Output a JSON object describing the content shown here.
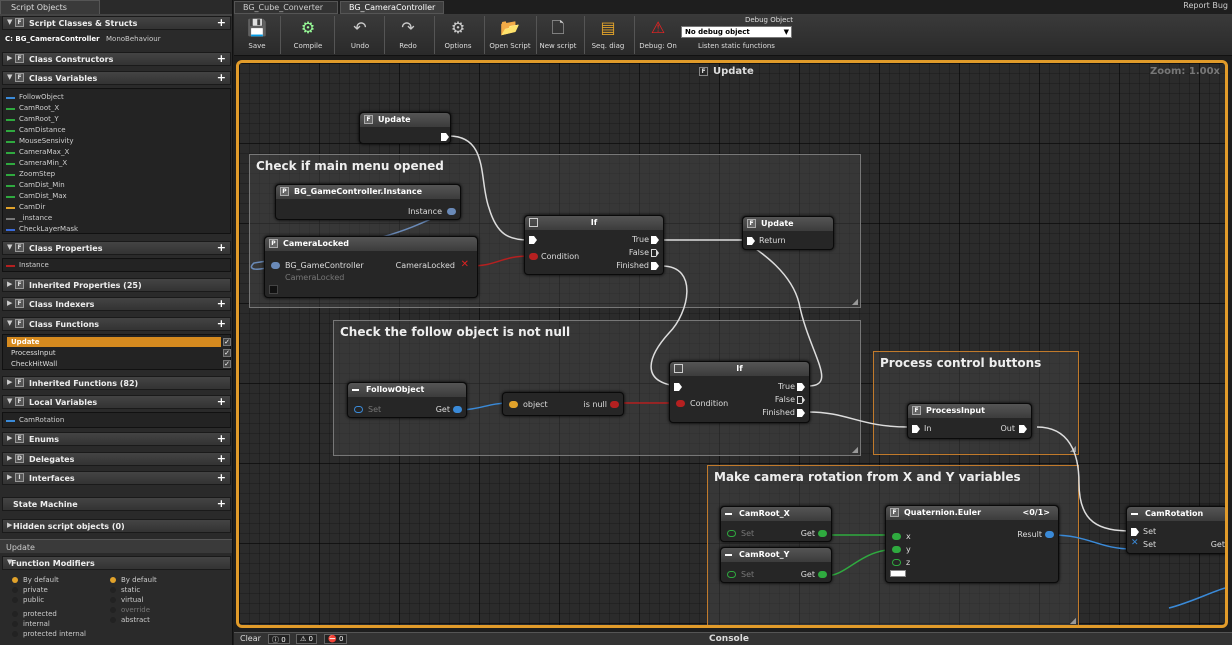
{
  "left_panel": {
    "tab": "Script Objects",
    "sections": {
      "script_classes": "Script Classes & Structs",
      "class_constructors": "Class Constructors",
      "class_variables": "Class Variables",
      "class_properties": "Class Properties",
      "inherited_properties": "Inherited Properties (25)",
      "class_indexers": "Class Indexers",
      "class_functions": "Class Functions",
      "inherited_functions": "Inherited Functions (82)",
      "local_variables": "Local Variables",
      "enums": "Enums",
      "delegates": "Delegates",
      "interfaces": "Interfaces",
      "state_machine": "State Machine",
      "hidden_objects": "Hidden script objects (0)",
      "function_modifiers": "Function Modifiers"
    },
    "class_entry": {
      "name": "C: BG_CameraController",
      "base": "MonoBehaviour"
    },
    "class_variables": [
      {
        "name": "FollowObject",
        "color": "#3a8ad8"
      },
      {
        "name": "CamRoot_X",
        "color": "#2faa3f"
      },
      {
        "name": "CamRoot_Y",
        "color": "#2faa3f"
      },
      {
        "name": "CamDistance",
        "color": "#2faa3f"
      },
      {
        "name": "MouseSensivity",
        "color": "#2faa3f"
      },
      {
        "name": "CameraMax_X",
        "color": "#2faa3f"
      },
      {
        "name": "CameraMin_X",
        "color": "#2faa3f"
      },
      {
        "name": "ZoomStep",
        "color": "#2faa3f"
      },
      {
        "name": "CamDist_Min",
        "color": "#2faa3f"
      },
      {
        "name": "CamDist_Max",
        "color": "#2faa3f"
      },
      {
        "name": "CamDir",
        "color": "#e1a22a"
      },
      {
        "name": "_instance",
        "color": "#777777"
      },
      {
        "name": "CheckLayerMask",
        "color": "#3a6ad8"
      }
    ],
    "class_properties": [
      {
        "name": "Instance",
        "color": "#b52020"
      }
    ],
    "class_functions": [
      "Update",
      "ProcessInput",
      "CheckHitWall"
    ],
    "local_variables": [
      {
        "name": "CamRotation",
        "color": "#3a8ad8"
      }
    ],
    "bottom_tab": "Update",
    "modifiers_left": [
      "By default",
      "private",
      "public",
      "protected",
      "internal",
      "protected internal"
    ],
    "modifiers_right": [
      "By default",
      "static",
      "virtual",
      "override",
      "abstract"
    ]
  },
  "tabs": [
    "BG_Cube_Converter",
    "BG_CameraController"
  ],
  "report_bug": "Report Bug",
  "toolbar": {
    "save": "Save",
    "compile": "Compile",
    "undo": "Undo",
    "redo": "Redo",
    "options": "Options",
    "open_script": "Open Script",
    "new_script": "New script",
    "seq_diag": "Seq. diag",
    "debug_on": "Debug: On",
    "debug_object_title": "Debug Object",
    "debug_object_value": "No debug object",
    "listen_static": "Listen static functions"
  },
  "graph": {
    "title": "Update",
    "zoom": "Zoom: 1.00x",
    "groups": {
      "g1": "Check if main menu opened",
      "g2": "Check the follow object is not null",
      "g3": "Process control buttons",
      "g4": "Make camera rotation from X and Y variables"
    },
    "nodes": {
      "update": {
        "title": "Update"
      },
      "instance": {
        "title": "BG_GameController.Instance",
        "out": "Instance"
      },
      "cameralocked": {
        "title": "CameraLocked",
        "in": "BG_GameController",
        "out": "CameraLocked",
        "sub": "CameraLocked"
      },
      "if1": {
        "title": "If",
        "condition": "Condition",
        "true": "True",
        "false": "False",
        "finished": "Finished"
      },
      "update_return": {
        "title": "Update",
        "return": "Return"
      },
      "follow": {
        "title": "FollowObject",
        "set": "Set",
        "get": "Get"
      },
      "isnull": {
        "object": "object",
        "result": "is null"
      },
      "if2": {
        "title": "If",
        "condition": "Condition",
        "true": "True",
        "false": "False",
        "finished": "Finished"
      },
      "processinput": {
        "title": "ProcessInput",
        "in": "In",
        "out": "Out"
      },
      "camroot_x": {
        "title": "CamRoot_X",
        "set": "Set",
        "get": "Get"
      },
      "camroot_y": {
        "title": "CamRoot_Y",
        "set": "Set",
        "get": "Get"
      },
      "euler": {
        "title": "Quaternion.Euler",
        "overload": "<0/1>",
        "result": "Result",
        "x": "x",
        "y": "y",
        "z": "z"
      },
      "camrotation": {
        "title": "CamRotation",
        "set1": "Set",
        "set2": "Set",
        "get": "Get"
      }
    }
  },
  "console": {
    "clear": "Clear",
    "counts": [
      "0",
      "0",
      "0"
    ],
    "title": "Console"
  }
}
